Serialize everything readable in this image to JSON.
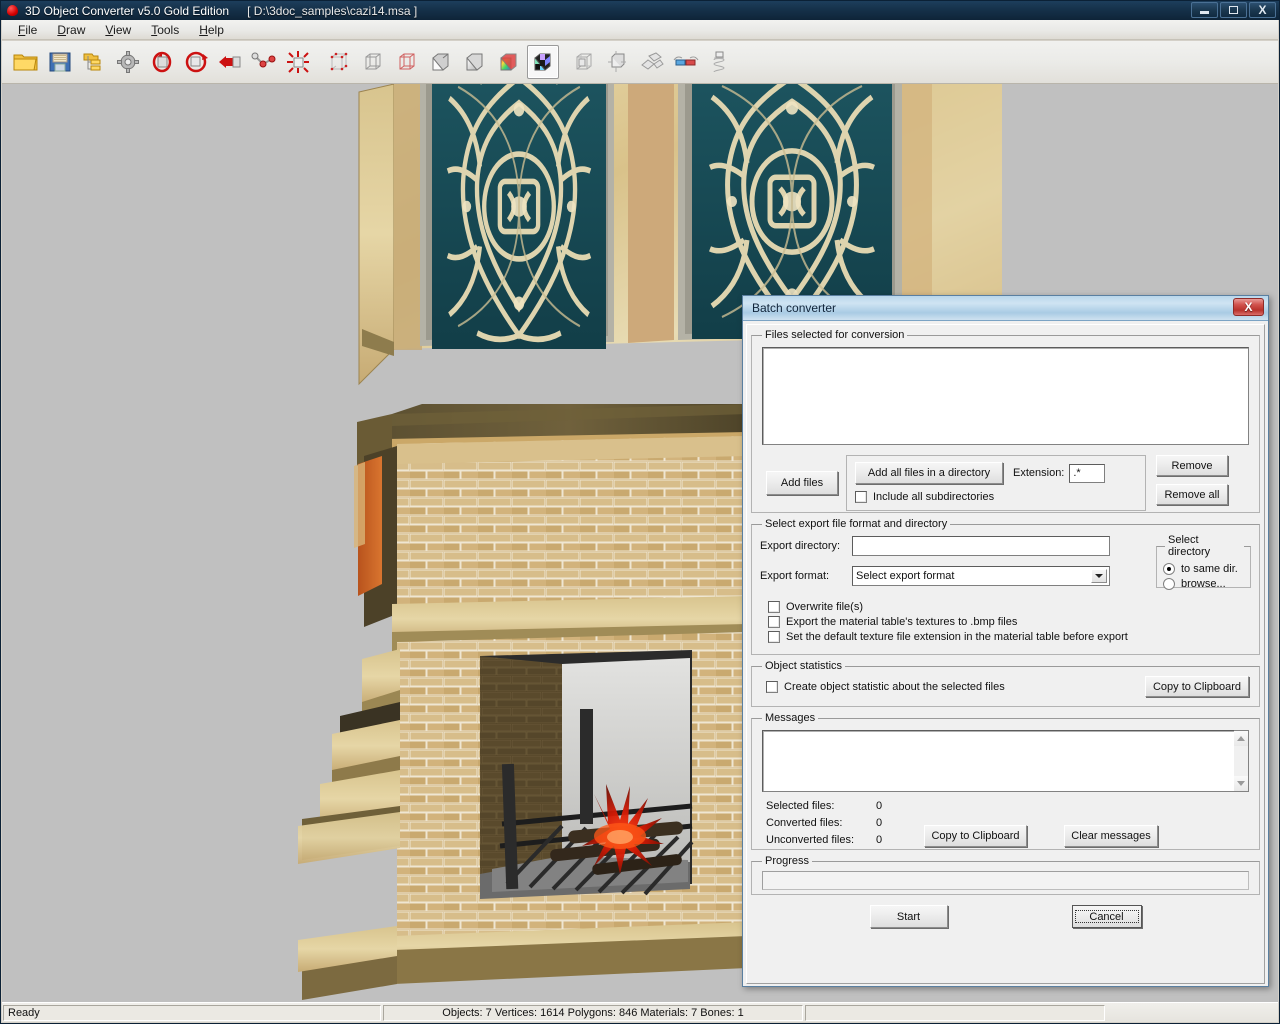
{
  "app": {
    "title": "3D Object Converter v5.0 Gold Edition",
    "file_path": "[ D:\\3doc_samples\\cazi14.msa ]",
    "app_icon": "red-sphere-icon",
    "window_buttons": {
      "minimize": "minimize-icon",
      "maximize": "restore-icon",
      "close": "X"
    }
  },
  "menu": {
    "items": [
      {
        "label": "File",
        "accel": "F"
      },
      {
        "label": "Draw",
        "accel": "D"
      },
      {
        "label": "View",
        "accel": "V"
      },
      {
        "label": "Tools",
        "accel": "T"
      },
      {
        "label": "Help",
        "accel": "H"
      }
    ]
  },
  "toolbar": {
    "buttons": [
      {
        "name": "open-folder-icon",
        "active": false
      },
      {
        "name": "save-floppy-icon",
        "active": false
      },
      {
        "name": "folder-list-icon",
        "active": false
      },
      {
        "name": "gear-settings-icon",
        "active": false
      },
      {
        "name": "rotate-x-icon",
        "active": false
      },
      {
        "name": "rotate-y-icon",
        "active": false
      },
      {
        "name": "flip-arrow-icon",
        "active": false
      },
      {
        "name": "node-link-icon",
        "active": false
      },
      {
        "name": "explode-icon",
        "active": false
      },
      {
        "name": "separator",
        "active": false
      },
      {
        "name": "wireframe-points-icon",
        "active": false
      },
      {
        "name": "wireframe-icon",
        "active": false
      },
      {
        "name": "wireframe-red-icon",
        "active": false
      },
      {
        "name": "flat-shaded-icon",
        "active": false
      },
      {
        "name": "smooth-shaded-icon",
        "active": false
      },
      {
        "name": "material-colored-icon",
        "active": false
      },
      {
        "name": "textured-icon",
        "active": true
      },
      {
        "name": "separator",
        "active": false
      },
      {
        "name": "bounding-box-icon",
        "active": false
      },
      {
        "name": "normals-icon",
        "active": false
      },
      {
        "name": "uv-unwrap-icon",
        "active": false
      },
      {
        "name": "stereo-glasses-icon",
        "active": false
      },
      {
        "name": "spring-coil-icon",
        "active": false
      }
    ]
  },
  "viewport": {
    "background_color": "#c0c0c0",
    "scene_description": "Textured 3D model of an ornate fireplace with carved panels, brick surround and burning fire grate"
  },
  "statusbar": {
    "ready": "Ready",
    "stats": "Objects: 7   Vertices: 1614   Polygons: 846   Materials: 7   Bones: 1",
    "extra": ""
  },
  "dialog": {
    "title": "Batch converter",
    "close_label": "X",
    "files_group": {
      "legend": "Files selected for conversion",
      "list_items": [],
      "add_files_label": "Add files",
      "add_directory_label": "Add all files in a directory",
      "extension_label": "Extension:",
      "extension_value": ".*",
      "include_subdirs_label": "Include all subdirectories",
      "include_subdirs_checked": false,
      "remove_label": "Remove",
      "remove_all_label": "Remove all"
    },
    "export_group": {
      "legend": "Select export file format and directory",
      "export_directory_label": "Export directory:",
      "export_directory_value": "",
      "export_format_label": "Export format:",
      "export_format_value": "Select export format",
      "select_directory_legend": "Select directory",
      "radio_same_dir": "to same dir.",
      "radio_browse": "browse...",
      "selected_radio": "to same dir.",
      "checkboxes": [
        {
          "label": "Overwrite file(s)",
          "checked": false
        },
        {
          "label": "Export the material table's textures to .bmp files",
          "checked": false
        },
        {
          "label": "Set the default texture file extension in the material table before export",
          "checked": false
        }
      ]
    },
    "statistics_group": {
      "legend": "Object statistics",
      "checkbox_label": "Create object statistic about the selected files",
      "checkbox_checked": false,
      "copy_button_label": "Copy to Clipboard"
    },
    "messages_group": {
      "legend": "Messages",
      "text": "",
      "counters": [
        {
          "label": "Selected files:",
          "value": "0"
        },
        {
          "label": "Converted files:",
          "value": "0"
        },
        {
          "label": "Unconverted files:",
          "value": "0"
        }
      ],
      "copy_button_label": "Copy to Clipboard",
      "clear_button_label": "Clear messages"
    },
    "progress_group": {
      "legend": "Progress",
      "value": 0
    },
    "start_label": "Start",
    "cancel_label": "Cancel"
  }
}
